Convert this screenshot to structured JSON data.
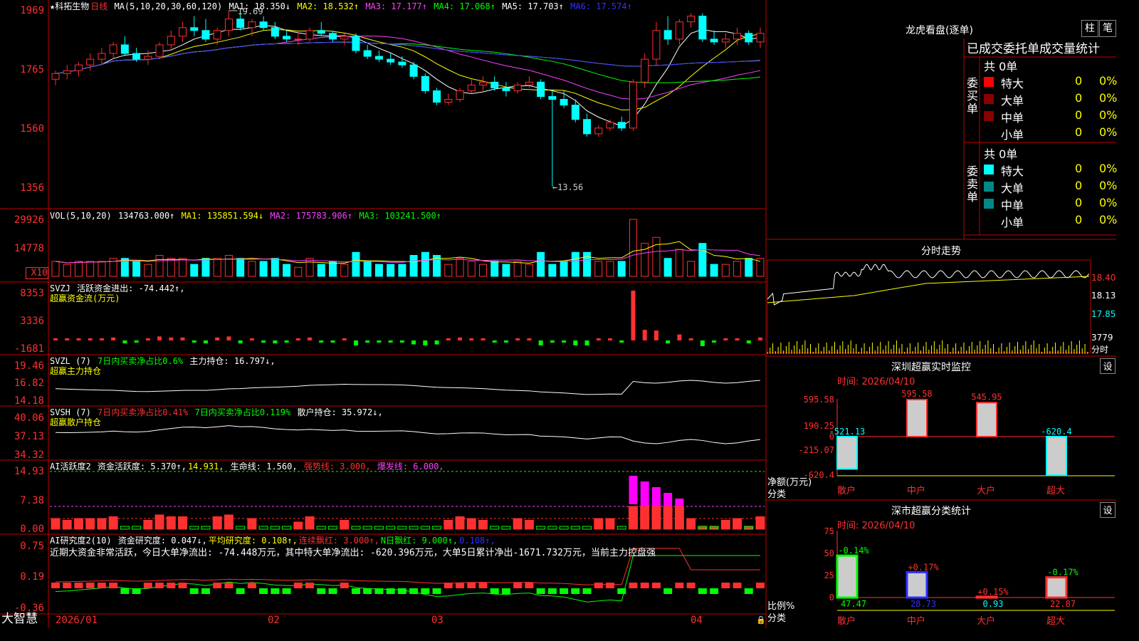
{
  "stock": {
    "name": "★科拓生物",
    "period": "日线"
  },
  "k_header": {
    "ma_def": "MA(5,10,20,30,60,120)",
    "ma1": "MA1: 18.350↓",
    "ma2": "MA2: 18.532↑",
    "ma3": "MA3: 17.177↑",
    "ma4": "MA4: 17.068↑",
    "ma5": "MA5: 17.703↑",
    "ma6": "MA6: 17.574↑"
  },
  "k_axis": {
    "ticks": [
      "1969",
      "1765",
      "1560",
      "1356"
    ],
    "high_label": "19.69",
    "low_label": "←13.56"
  },
  "vol_header": {
    "def": "VOL(5,10,20)",
    "val": "134763.000↑",
    "ma1": "MA1: 135851.594↓",
    "ma2": "MA2: 175783.906↑",
    "ma3": "MA3: 103241.500↑"
  },
  "vol_axis": {
    "ticks": [
      "29926",
      "14778"
    ],
    "unit": "X10"
  },
  "svzj": {
    "def": "SVZJ",
    "t1": "活跃资金进出: -74.442↑,",
    "t2": "超赢资金流(万元)",
    "ticks": [
      "8353",
      "3336",
      "-1681"
    ]
  },
  "svzl": {
    "def": "SVZL (7)",
    "t1": "7日内买卖净占比0.6%",
    "t2": "主力持仓: 16.797↓,",
    "t3": "超赢主力持仓",
    "ticks": [
      "19.46",
      "16.82",
      "14.18"
    ]
  },
  "svsh": {
    "def": "SVSH (7)",
    "t1": "7日内买卖净占比0.41%",
    "t2": "7日内买卖净占比0.119%",
    "t3": "散户持仓: 35.972↓,",
    "t4": "超赢散户持仓",
    "ticks": [
      "40.06",
      "37.13",
      "34.32"
    ]
  },
  "ai1": {
    "def": "AI活跃度2",
    "t1": "资金活跃度: 5.370↑,",
    "t2": "14.931,",
    "t3": "生命线: 1.560,",
    "t4": "强势线: 3.000,",
    "t5": "爆发线: 6.000,",
    "ticks": [
      "14.93",
      "7.38",
      "0.00"
    ]
  },
  "ai2": {
    "def": "AI研究度2(10)",
    "t1": "资金研究度: 0.047↓,",
    "t2": "平均研究度: 0.108↑,",
    "t3": "连续飘红: 3.000↑,",
    "t4": "N日飘红: 9.000↑,",
    "t5": "0.108↑,",
    "note": "近期大资金非常活跃，今日大单净流出: -74.448万元，其中特大单净流出: -620.396万元，大单5日累计净出-1671.732万元，当前主力控盘强",
    "ticks": [
      "0.75",
      "0.19",
      "-0.36"
    ]
  },
  "xaxis": {
    "labels": [
      "2026/01",
      "02",
      "03",
      "04"
    ]
  },
  "footer": {
    "brand": "大智慧"
  },
  "lhb": {
    "title": "龙虎看盘(逐单)",
    "btn1": "柱",
    "btn2": "笔",
    "tab": "已成交委托单成交量统计",
    "buy": {
      "side": "委买单",
      "total": "共 0单",
      "rows": [
        {
          "name": "特大",
          "n": "0",
          "p": "0%"
        },
        {
          "name": "大单",
          "n": "0",
          "p": "0%"
        },
        {
          "name": "中单",
          "n": "0",
          "p": "0%"
        },
        {
          "name": "小单",
          "n": "0",
          "p": "0%"
        }
      ]
    },
    "sell": {
      "side": "委卖单",
      "total": "共 0单",
      "rows": [
        {
          "name": "特大",
          "n": "0",
          "p": "0%"
        },
        {
          "name": "大单",
          "n": "0",
          "p": "0%"
        },
        {
          "name": "中单",
          "n": "0",
          "p": "0%"
        },
        {
          "name": "小单",
          "n": "0",
          "p": "0%"
        }
      ]
    }
  },
  "fenshi": {
    "title": "分时走势",
    "prices": [
      "18.40",
      "18.13",
      "17.85"
    ],
    "vol": "3779",
    "vol_unit": "分时"
  },
  "monitor": {
    "title": "深圳超赢实时监控",
    "btn": "设",
    "time": "时间: 2026/04/10",
    "ticks": [
      "595.58",
      "190.25",
      "0",
      "-215.07",
      "-620.4"
    ],
    "ylab": "净额(万元)",
    "xlab": "分类",
    "cats": [
      "散户",
      "中户",
      "大户",
      "超大"
    ],
    "values": [
      -521.13,
      595.58,
      545.95,
      -620.4
    ],
    "labels": [
      "-521.13",
      "595.58",
      "545.95",
      "-620.4"
    ]
  },
  "classify": {
    "title": "深市超赢分类统计",
    "btn": "设",
    "time": "时间: 2026/04/10",
    "ticks": [
      "75",
      "50",
      "25",
      "0"
    ],
    "ylab": "比例%",
    "xlab": "分类",
    "cats": [
      "散户",
      "中户",
      "大户",
      "超大"
    ],
    "values": [
      47.47,
      28.73,
      0.93,
      22.87
    ],
    "labels": [
      "47.47",
      "28.73",
      "0.93",
      "22.87"
    ],
    "changes": [
      "-0.14%",
      "+0.17%",
      "+0.15%",
      "-0.17%"
    ]
  },
  "chart_data": [
    {
      "type": "candlestick",
      "title": "科拓生物 日线",
      "ylim": [
        13.2,
        20.0
      ],
      "ohlc": [
        [
          17.3,
          17.6,
          17.1,
          17.5
        ],
        [
          17.5,
          17.8,
          17.3,
          17.6
        ],
        [
          17.6,
          17.9,
          17.4,
          17.8
        ],
        [
          17.8,
          18.2,
          17.6,
          18.0
        ],
        [
          18.0,
          18.4,
          17.8,
          18.2
        ],
        [
          18.2,
          18.6,
          18.0,
          18.5
        ],
        [
          18.5,
          18.8,
          18.1,
          18.2
        ],
        [
          18.2,
          18.4,
          17.9,
          18.0
        ],
        [
          18.0,
          18.3,
          17.8,
          18.1
        ],
        [
          18.1,
          18.6,
          18.0,
          18.5
        ],
        [
          18.5,
          19.0,
          18.3,
          18.8
        ],
        [
          18.8,
          19.3,
          18.6,
          19.1
        ],
        [
          19.1,
          19.5,
          18.8,
          19.0
        ],
        [
          19.0,
          19.4,
          18.6,
          18.7
        ],
        [
          18.7,
          19.1,
          18.5,
          19.0
        ],
        [
          19.0,
          19.69,
          18.8,
          19.4
        ],
        [
          19.4,
          19.6,
          19.0,
          19.1
        ],
        [
          19.1,
          19.4,
          18.8,
          19.3
        ],
        [
          19.3,
          19.5,
          19.0,
          19.1
        ],
        [
          19.1,
          19.3,
          18.7,
          18.8
        ],
        [
          18.8,
          19.0,
          18.6,
          18.7
        ],
        [
          18.7,
          19.0,
          18.5,
          18.7
        ],
        [
          18.7,
          19.1,
          18.6,
          19.0
        ],
        [
          19.0,
          19.3,
          18.8,
          18.9
        ],
        [
          18.9,
          19.0,
          18.6,
          18.7
        ],
        [
          18.7,
          18.9,
          18.5,
          18.8
        ],
        [
          18.8,
          18.9,
          18.2,
          18.3
        ],
        [
          18.3,
          18.5,
          18.0,
          18.1
        ],
        [
          18.1,
          18.3,
          17.9,
          18.0
        ],
        [
          18.0,
          18.2,
          17.8,
          17.9
        ],
        [
          17.9,
          18.1,
          17.7,
          17.8
        ],
        [
          17.8,
          17.9,
          17.3,
          17.4
        ],
        [
          17.4,
          17.5,
          16.8,
          16.9
        ],
        [
          16.9,
          17.0,
          16.4,
          16.5
        ],
        [
          16.5,
          16.8,
          16.4,
          16.6
        ],
        [
          16.6,
          17.0,
          16.5,
          16.9
        ],
        [
          16.9,
          17.3,
          16.8,
          17.1
        ],
        [
          17.1,
          17.4,
          16.9,
          17.2
        ],
        [
          17.2,
          17.4,
          16.9,
          17.0
        ],
        [
          17.0,
          17.2,
          16.7,
          16.9
        ],
        [
          16.9,
          17.2,
          16.8,
          17.1
        ],
        [
          17.1,
          17.4,
          17.0,
          17.2
        ],
        [
          17.2,
          17.3,
          16.6,
          16.7
        ],
        [
          16.7,
          16.9,
          13.56,
          16.6
        ],
        [
          16.6,
          16.9,
          16.3,
          16.4
        ],
        [
          16.4,
          16.6,
          15.8,
          15.9
        ],
        [
          15.9,
          16.1,
          15.3,
          15.4
        ],
        [
          15.4,
          15.7,
          15.3,
          15.6
        ],
        [
          15.6,
          15.9,
          15.5,
          15.8
        ],
        [
          15.8,
          16.0,
          15.5,
          15.6
        ],
        [
          15.6,
          17.3,
          15.5,
          17.2
        ],
        [
          17.2,
          18.2,
          17.0,
          18.0
        ],
        [
          18.0,
          19.3,
          17.8,
          19.0
        ],
        [
          19.0,
          19.5,
          18.5,
          18.7
        ],
        [
          18.7,
          19.4,
          18.5,
          19.3
        ],
        [
          19.3,
          19.6,
          19.1,
          19.5
        ],
        [
          19.5,
          19.6,
          18.6,
          18.7
        ],
        [
          18.7,
          19.0,
          18.5,
          18.6
        ],
        [
          18.6,
          18.9,
          18.4,
          18.7
        ],
        [
          18.7,
          19.1,
          18.5,
          18.9
        ],
        [
          18.9,
          19.0,
          18.5,
          18.6
        ],
        [
          18.6,
          19.1,
          18.4,
          18.9
        ]
      ]
    },
    {
      "type": "bar",
      "title": "深圳超赢实时监控",
      "categories": [
        "散户",
        "中户",
        "大户",
        "超大"
      ],
      "values": [
        -521.13,
        595.58,
        545.95,
        -620.4
      ],
      "ylabel": "净额(万元)",
      "ylim": [
        -620.4,
        595.58
      ]
    },
    {
      "type": "bar",
      "title": "深市超赢分类统计",
      "categories": [
        "散户",
        "中户",
        "大户",
        "超大"
      ],
      "values": [
        47.47,
        28.73,
        0.93,
        22.87
      ],
      "ylabel": "比例%",
      "ylim": [
        0,
        75
      ]
    }
  ]
}
